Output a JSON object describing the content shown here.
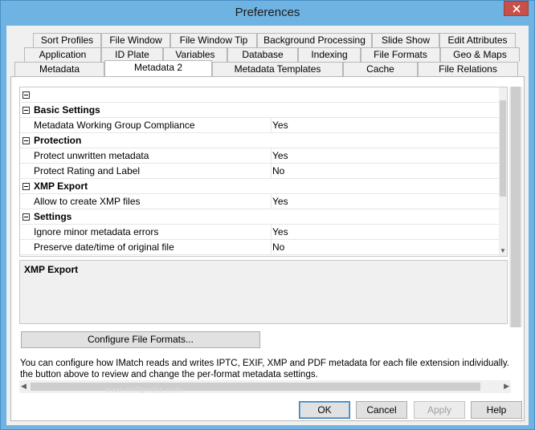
{
  "window": {
    "title": "Preferences"
  },
  "tabs": {
    "row1": [
      "Sort Profiles",
      "File Window",
      "File Window Tip",
      "Background Processing",
      "Slide Show",
      "Edit Attributes"
    ],
    "row2": [
      "Application",
      "ID Plate",
      "Variables",
      "Database",
      "Indexing",
      "File Formats",
      "Geo & Maps"
    ],
    "row3": [
      "Metadata",
      "Metadata 2",
      "Metadata Templates",
      "Cache",
      "File Relations"
    ],
    "active": "Metadata 2"
  },
  "grid": {
    "rows": [
      {
        "type": "cat",
        "name": ""
      },
      {
        "type": "cat",
        "name": "Basic Settings"
      },
      {
        "type": "item",
        "name": "Metadata Working Group Compliance",
        "value": "Yes"
      },
      {
        "type": "cat",
        "name": "Protection"
      },
      {
        "type": "item",
        "name": "Protect unwritten metadata",
        "value": "Yes"
      },
      {
        "type": "item",
        "name": "Protect Rating and Label",
        "value": "No"
      },
      {
        "type": "cat",
        "name": "XMP Export"
      },
      {
        "type": "item",
        "name": "Allow to create XMP files",
        "value": "Yes"
      },
      {
        "type": "cat",
        "name": "Settings"
      },
      {
        "type": "item",
        "name": "Ignore minor metadata errors",
        "value": "Yes"
      },
      {
        "type": "item",
        "name": "Preserve date/time of original file",
        "value": "No"
      }
    ]
  },
  "description": {
    "title": "XMP Export"
  },
  "configure_button": "Configure File Formats...",
  "info_lines": [
    "You can configure how IMatch reads and writes IPTC, EXIF, XMP and PDF metadata for each file extension individually. Click on",
    "the button above to review and change the per-format metadata settings."
  ],
  "watermark": "www.softpedia.com",
  "buttons": {
    "ok": "OK",
    "cancel": "Cancel",
    "apply": "Apply",
    "help": "Help"
  }
}
